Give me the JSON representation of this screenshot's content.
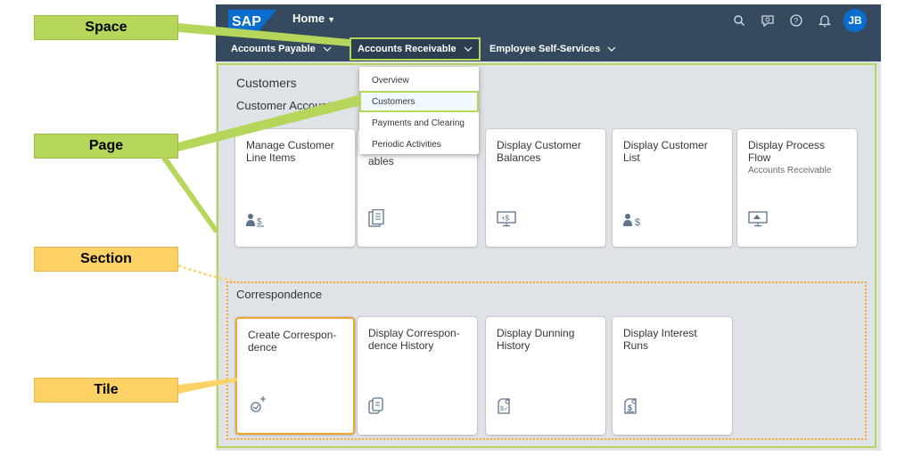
{
  "callouts": {
    "space": "Space",
    "page": "Page",
    "section": "Section",
    "tile": "Tile"
  },
  "shell": {
    "logo": "SAP",
    "title": "Home",
    "avatar_initials": "JB",
    "icons": [
      "search-icon",
      "feedback-icon",
      "help-icon",
      "notifications-icon"
    ]
  },
  "spaces": [
    {
      "label": "Accounts Payable"
    },
    {
      "label": "Accounts Receivable"
    },
    {
      "label": "Employee Self-Services"
    }
  ],
  "menu": {
    "items": [
      "Overview",
      "Customers",
      "Payments and Clearing",
      "Periodic Activities"
    ],
    "selected": "Customers"
  },
  "page": {
    "title": "Customers",
    "sections": [
      {
        "title": "Customer Accounts",
        "tiles": [
          {
            "title": "Manage Customer\nLine Items",
            "icon": "customer-dollar-icon"
          },
          {
            "title": "ables",
            "icon": "document-list-icon"
          },
          {
            "title": "Display Customer\nBalances",
            "icon": "monitor-plus-dollar-icon"
          },
          {
            "title": "Display Customer\nList",
            "icon": "customer-dollar-icon"
          },
          {
            "title": "Display Process\nFlow",
            "subtitle": "Accounts Receivable",
            "icon": "monitor-process-icon"
          }
        ]
      },
      {
        "title": "Correspondence",
        "tiles": [
          {
            "title": "Create Correspon-\ndence",
            "icon": "create-sparkle-icon"
          },
          {
            "title": "Display Correspon-\ndence History",
            "icon": "history-documents-icon"
          },
          {
            "title": "Display Dunning\nHistory",
            "icon": "dunning-document-icon"
          },
          {
            "title": "Display Interest\nRuns",
            "icon": "interest-document-icon"
          }
        ]
      }
    ]
  },
  "colors": {
    "shell": "#354a5f",
    "page_bg": "#dfe3e7",
    "highlight_green": "#b5d65a",
    "highlight_orange": "#f3a62e",
    "accent_blue": "#0a6ed1"
  }
}
